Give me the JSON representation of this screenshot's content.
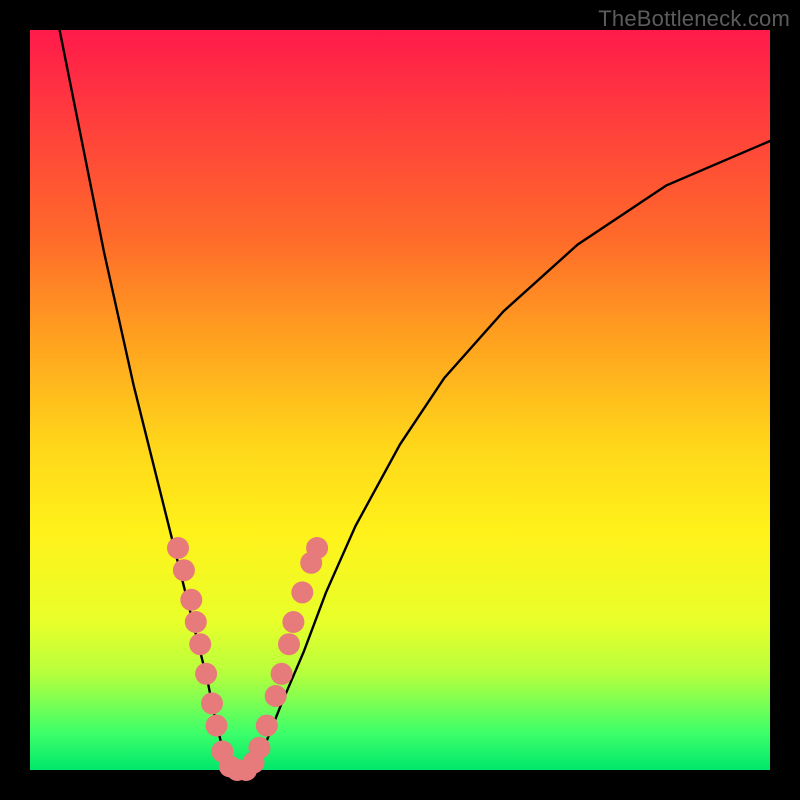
{
  "watermark": "TheBottleneck.com",
  "chart_data": {
    "type": "line",
    "title": "",
    "xlabel": "",
    "ylabel": "",
    "xlim": [
      0,
      100
    ],
    "ylim": [
      0,
      100
    ],
    "series": [
      {
        "name": "bottleneck-curve",
        "x": [
          4,
          6,
          8,
          10,
          12,
          14,
          16,
          18,
          20,
          22,
          24,
          25,
          26,
          27,
          28,
          29,
          30,
          32,
          34,
          37,
          40,
          44,
          50,
          56,
          64,
          74,
          86,
          100
        ],
        "y": [
          100,
          90,
          80,
          70,
          61,
          52,
          44,
          36,
          28,
          20,
          12,
          7,
          3,
          1,
          0,
          0,
          1,
          4,
          9,
          16,
          24,
          33,
          44,
          53,
          62,
          71,
          79,
          85
        ]
      }
    ],
    "markers": [
      {
        "name": "highlight-points",
        "color": "#e77a7a",
        "points": [
          {
            "x": 20.0,
            "y": 30
          },
          {
            "x": 20.8,
            "y": 27
          },
          {
            "x": 21.8,
            "y": 23
          },
          {
            "x": 22.4,
            "y": 20
          },
          {
            "x": 23.0,
            "y": 17
          },
          {
            "x": 23.8,
            "y": 13
          },
          {
            "x": 24.6,
            "y": 9
          },
          {
            "x": 25.2,
            "y": 6
          },
          {
            "x": 26.0,
            "y": 2.5
          },
          {
            "x": 27.0,
            "y": 0.5
          },
          {
            "x": 28.0,
            "y": 0
          },
          {
            "x": 29.2,
            "y": 0
          },
          {
            "x": 30.2,
            "y": 1
          },
          {
            "x": 31.0,
            "y": 3
          },
          {
            "x": 32.0,
            "y": 6
          },
          {
            "x": 33.2,
            "y": 10
          },
          {
            "x": 34.0,
            "y": 13
          },
          {
            "x": 35.0,
            "y": 17
          },
          {
            "x": 35.6,
            "y": 20
          },
          {
            "x": 36.8,
            "y": 24
          },
          {
            "x": 38.0,
            "y": 28
          },
          {
            "x": 38.8,
            "y": 30
          }
        ]
      }
    ]
  }
}
